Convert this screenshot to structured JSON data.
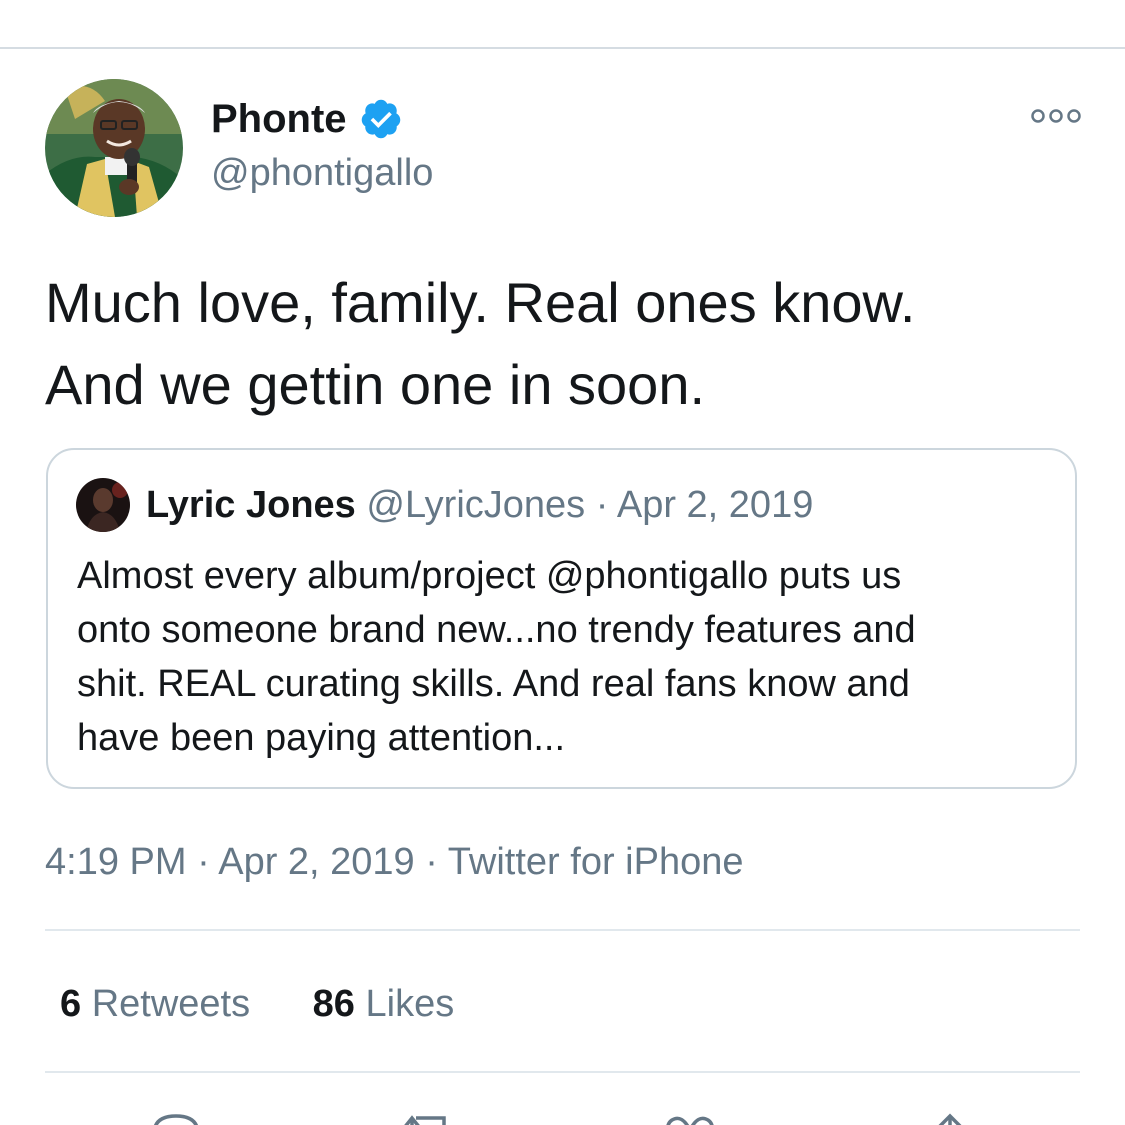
{
  "tweet": {
    "author": {
      "display_name": "Phonte",
      "handle": "@phontigallo",
      "verified": true
    },
    "text_lines": [
      "Much love, family. Real ones know.",
      "And we gettin one in soon."
    ],
    "quoted": {
      "display_name": "Lyric Jones",
      "handle": "@LyricJones",
      "separator": "·",
      "date": "Apr 2, 2019",
      "text_lines": [
        "Almost every album/project @phontigallo puts us",
        "onto someone brand new...no trendy features and",
        "shit. REAL curating skills. And real fans know and",
        "have been paying attention..."
      ]
    },
    "meta": {
      "time": "4:19 PM",
      "separator": "·",
      "date": "Apr 2, 2019",
      "source": "Twitter for iPhone"
    },
    "stats": {
      "retweets_count": "6",
      "retweets_label": "Retweets",
      "likes_count": "86",
      "likes_label": "Likes"
    }
  },
  "icons": {
    "more": "more-options-icon",
    "verified": "verified-badge-icon",
    "reply": "reply-icon",
    "retweet": "retweet-icon",
    "like": "heart-icon",
    "share": "share-icon"
  },
  "colors": {
    "text_primary": "#14171a",
    "text_secondary": "#657786",
    "verified_blue": "#1da1f2",
    "border": "#ccd6dd"
  }
}
